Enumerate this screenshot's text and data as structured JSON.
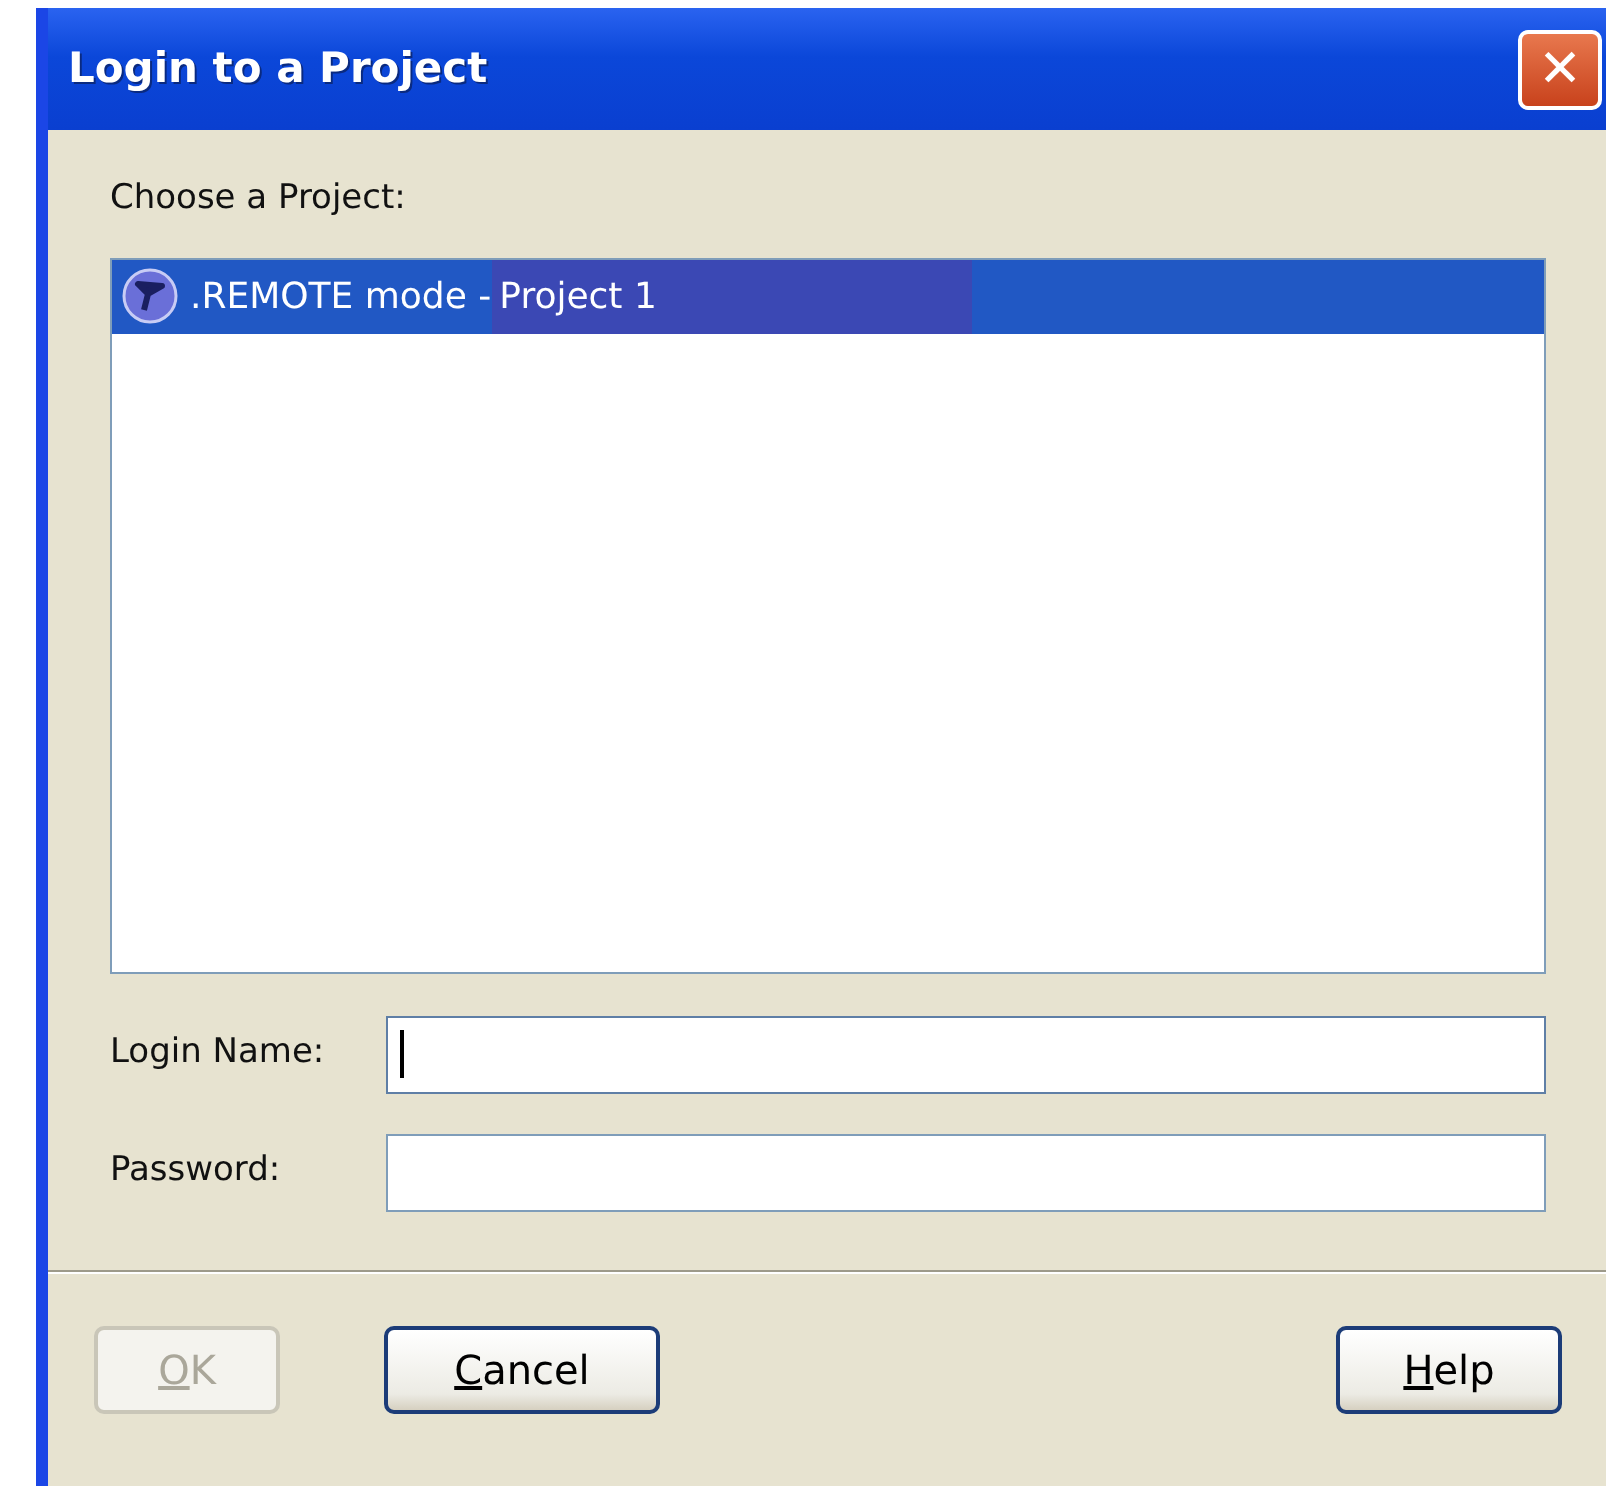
{
  "window": {
    "title": "Login to a Project",
    "close": "✕"
  },
  "project_list": {
    "label": "Choose a Project:",
    "items": [
      {
        "text": ".REMOTE mode -",
        "project": "Project 1",
        "selected": true
      }
    ]
  },
  "fields": [
    {
      "label": "Login Name:",
      "focused": true
    },
    {
      "label": "Password:",
      "focused": false
    }
  ],
  "buttons": [
    {
      "label": "OK",
      "disabled": true,
      "mnemonic_first": true
    },
    {
      "label": "Cancel",
      "disabled": false,
      "mnemonic_first": true
    },
    {
      "label": "Help",
      "disabled": false,
      "mnemonic_first": true
    }
  ]
}
